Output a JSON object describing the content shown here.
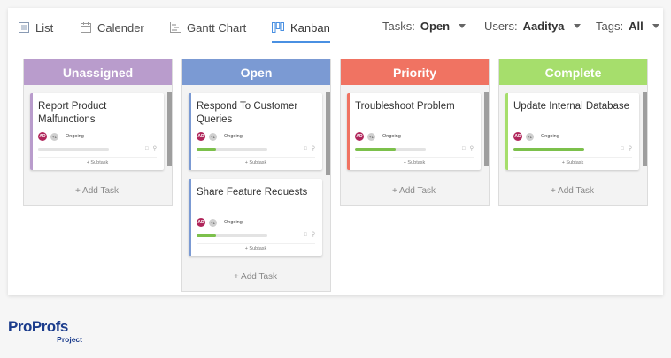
{
  "tabs": [
    {
      "label": "List",
      "icon": "list-icon"
    },
    {
      "label": "Calender",
      "icon": "calendar-icon"
    },
    {
      "label": "Gantt Chart",
      "icon": "gantt-icon"
    },
    {
      "label": "Kanban",
      "icon": "kanban-icon",
      "active": true
    }
  ],
  "filters": {
    "tasks": {
      "label": "Tasks:",
      "value": "Open"
    },
    "users": {
      "label": "Users:",
      "value": "Aaditya"
    },
    "tags": {
      "label": "Tags:",
      "value": "All"
    }
  },
  "columns": [
    {
      "title": "Unassigned",
      "color": "#b99ccc",
      "cards": [
        {
          "title": "Report Product Malfunctions",
          "avatar": "AD",
          "more": "+1",
          "status": "Ongoing",
          "progress": 0,
          "subtask": "+ Subtask",
          "accent": "#b99ccc"
        }
      ],
      "add_label": "+ Add Task"
    },
    {
      "title": "Open",
      "color": "#7b9ad3",
      "cards": [
        {
          "title": "Respond To Customer Queries",
          "avatar": "AD",
          "more": "+1",
          "status": "Ongoing",
          "progress": 0.27,
          "subtask": "+ Subtask",
          "accent": "#7b9ad3"
        },
        {
          "title": "Share Feature Requests",
          "avatar": "AD",
          "more": "+1",
          "status": "Ongoing",
          "progress": 0.27,
          "subtask": "+ Subtask",
          "accent": "#7b9ad3"
        }
      ],
      "add_label": "+ Add Task"
    },
    {
      "title": "Priority",
      "color": "#f07362",
      "cards": [
        {
          "title": "Troubleshoot Problem",
          "avatar": "AD",
          "more": "+1",
          "status": "Ongoing",
          "progress": 0.58,
          "subtask": "+ Subtask",
          "accent": "#f07362"
        }
      ],
      "add_label": "+ Add Task"
    },
    {
      "title": "Complete",
      "color": "#a6de6c",
      "cards": [
        {
          "title": "Update Internal Database",
          "avatar": "AD",
          "more": "+1",
          "status": "Ongoing",
          "progress": 1.0,
          "subtask": "+ Subtask",
          "accent": "#a6de6c"
        }
      ],
      "add_label": "+ Add Task"
    }
  ],
  "logo": {
    "main_a": "Pro",
    "main_b": "Profs",
    "sub": "Project"
  },
  "colors": {
    "accent": "#4a90e2",
    "progress": "#7cc04b"
  }
}
